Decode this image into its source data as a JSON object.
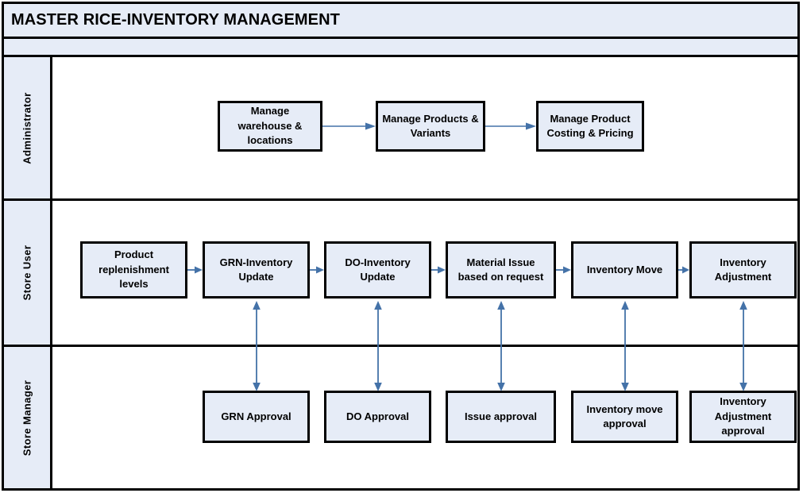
{
  "header": {
    "title": "MASTER RICE-INVENTORY MANAGEMENT"
  },
  "colors": {
    "band_fill": "#e6ecf7",
    "node_fill": "#e6ecf7",
    "node_border": "#000000",
    "arrow": "#4472a8",
    "frame": "#000000"
  },
  "lanes": [
    {
      "label": "Administrator",
      "nodes": [
        {
          "id": "manage-warehouse-locations",
          "label": "Manage warehouse & locations"
        },
        {
          "id": "manage-products-variants",
          "label": "Manage Products & Variants"
        },
        {
          "id": "manage-product-costing-pricing",
          "label": "Manage Product Costing & Pricing"
        }
      ]
    },
    {
      "label": "Store User",
      "nodes": [
        {
          "id": "product-replenishment-levels",
          "label": "Product replenishment levels"
        },
        {
          "id": "grn-inventory-update",
          "label": "GRN-Inventory Update"
        },
        {
          "id": "do-inventory-update",
          "label": "DO-Inventory Update"
        },
        {
          "id": "material-issue-based-on-request",
          "label": "Material Issue based on request"
        },
        {
          "id": "inventory-move",
          "label": "Inventory Move"
        },
        {
          "id": "inventory-adjustment",
          "label": "Inventory Adjustment"
        }
      ]
    },
    {
      "label": "Store Manager",
      "nodes": [
        {
          "id": "grn-approval",
          "label": "GRN Approval"
        },
        {
          "id": "do-approval",
          "label": "DO Approval"
        },
        {
          "id": "issue-approval",
          "label": "Issue approval"
        },
        {
          "id": "inventory-move-approval",
          "label": "Inventory move approval"
        },
        {
          "id": "inventory-adjustment-approval",
          "label": "Inventory Adjustment approval"
        }
      ]
    }
  ],
  "connectors": {
    "administrator_flow": [
      {
        "from": "manage-warehouse-locations",
        "to": "manage-products-variants",
        "kind": "arrow-right"
      },
      {
        "from": "manage-products-variants",
        "to": "manage-product-costing-pricing",
        "kind": "arrow-right"
      }
    ],
    "store_user_flow": [
      {
        "from": "product-replenishment-levels",
        "to": "grn-inventory-update",
        "kind": "arrow-right"
      },
      {
        "from": "grn-inventory-update",
        "to": "do-inventory-update",
        "kind": "arrow-right"
      },
      {
        "from": "do-inventory-update",
        "to": "material-issue-based-on-request",
        "kind": "arrow-right"
      },
      {
        "from": "material-issue-based-on-request",
        "to": "inventory-move",
        "kind": "arrow-right"
      },
      {
        "from": "inventory-move",
        "to": "inventory-adjustment",
        "kind": "arrow-right"
      }
    ],
    "approval_links": [
      {
        "from": "grn-inventory-update",
        "to": "grn-approval",
        "kind": "double-arrow-vertical"
      },
      {
        "from": "do-inventory-update",
        "to": "do-approval",
        "kind": "double-arrow-vertical"
      },
      {
        "from": "material-issue-based-on-request",
        "to": "issue-approval",
        "kind": "double-arrow-vertical"
      },
      {
        "from": "inventory-move",
        "to": "inventory-move-approval",
        "kind": "double-arrow-vertical"
      },
      {
        "from": "inventory-adjustment",
        "to": "inventory-adjustment-approval",
        "kind": "double-arrow-vertical"
      }
    ]
  }
}
